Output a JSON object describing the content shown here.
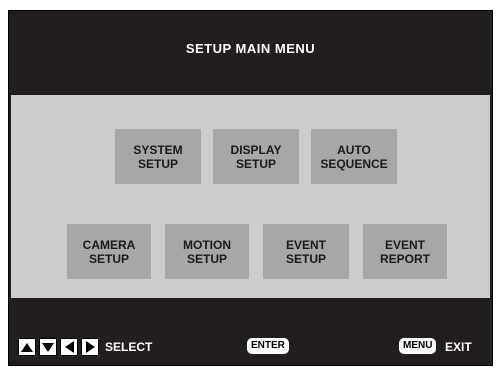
{
  "title": "SETUP MAIN MENU",
  "menu_row1": [
    {
      "line1": "SYSTEM",
      "line2": "SETUP"
    },
    {
      "line1": "DISPLAY",
      "line2": "SETUP"
    },
    {
      "line1": "AUTO",
      "line2": "SEQUENCE"
    }
  ],
  "menu_row2": [
    {
      "line1": "CAMERA",
      "line2": "SETUP"
    },
    {
      "line1": "MOTION",
      "line2": "SETUP"
    },
    {
      "line1": "EVENT",
      "line2": "SETUP"
    },
    {
      "line1": "EVENT",
      "line2": "REPORT"
    }
  ],
  "footer": {
    "select_label": "SELECT",
    "enter_key": "ENTER",
    "menu_key": "MENU",
    "exit_label": "EXIT",
    "arrow_icons": [
      "arrow-up-icon",
      "arrow-down-icon",
      "arrow-left-icon",
      "arrow-right-icon"
    ]
  },
  "colors": {
    "background": "#231e1e",
    "panel": "#cccccc",
    "button": "#a7a7a7"
  }
}
